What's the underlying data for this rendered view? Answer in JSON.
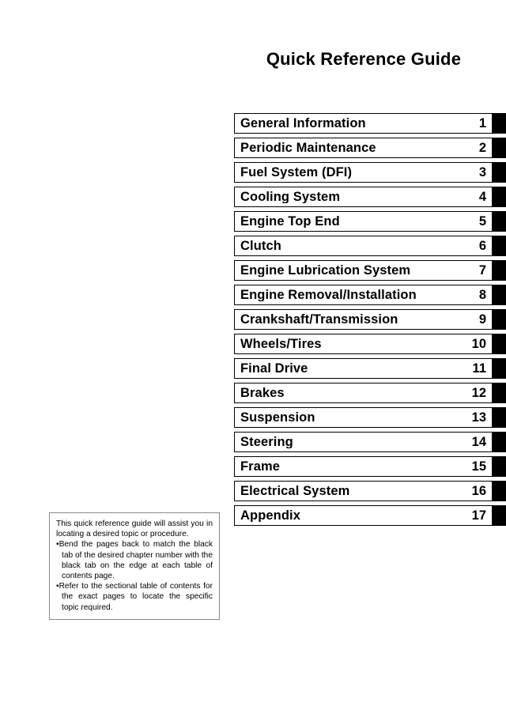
{
  "document": {
    "title": "Quick Reference Guide"
  },
  "chapters": [
    {
      "name": "General Information",
      "number": "1"
    },
    {
      "name": "Periodic Maintenance",
      "number": "2"
    },
    {
      "name": "Fuel System (DFI)",
      "number": "3"
    },
    {
      "name": "Cooling System",
      "number": "4"
    },
    {
      "name": "Engine Top End",
      "number": "5"
    },
    {
      "name": "Clutch",
      "number": "6"
    },
    {
      "name": "Engine Lubrication System",
      "number": "7"
    },
    {
      "name": "Engine Removal/Installation",
      "number": "8"
    },
    {
      "name": "Crankshaft/Transmission",
      "number": "9"
    },
    {
      "name": "Wheels/Tires",
      "number": "10"
    },
    {
      "name": "Final Drive",
      "number": "11"
    },
    {
      "name": "Brakes",
      "number": "12"
    },
    {
      "name": "Suspension",
      "number": "13"
    },
    {
      "name": "Steering",
      "number": "14"
    },
    {
      "name": "Frame",
      "number": "15"
    },
    {
      "name": "Electrical System",
      "number": "16"
    },
    {
      "name": "Appendix",
      "number": "17"
    }
  ],
  "note": {
    "intro": "This quick reference guide will assist you in locating a desired topic or procedure.",
    "bullets": [
      "•Bend the pages back to match the black tab of the desired chapter number with the black tab on the edge at each table of contents page.",
      "•Refer to the sectional table of contents for the exact pages to locate the specific topic required."
    ]
  },
  "colors": {
    "tab": "#000000",
    "box_border": "#000000",
    "note_border": "#8a8a8a",
    "page_background": "#ffffff"
  }
}
